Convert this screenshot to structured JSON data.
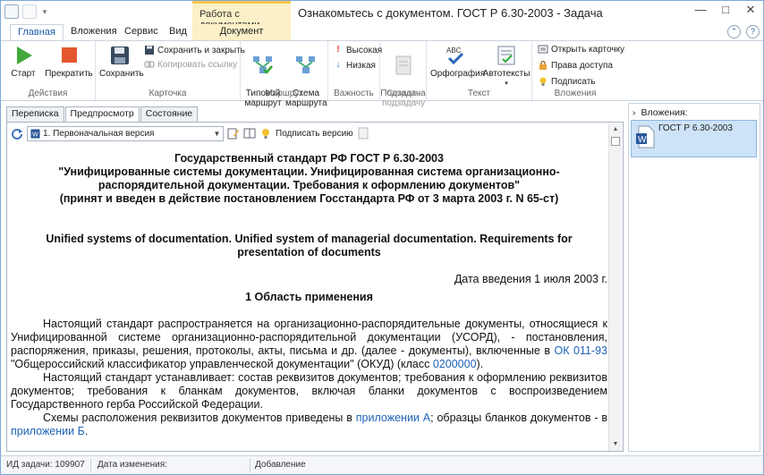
{
  "window": {
    "context_tab_caption": "Работа с документами",
    "title": "Ознакомьтесь с документом. ГОСТ Р 6.30-2003 - Задача",
    "controls": [
      "—",
      "□",
      "✕"
    ]
  },
  "ribbon_tabs": [
    {
      "label": "Главная",
      "active": true
    },
    {
      "label": "Вложения"
    },
    {
      "label": "Сервис"
    },
    {
      "label": "Вид"
    },
    {
      "label": "Документ",
      "contextual": true
    }
  ],
  "ribbon": {
    "groups": {
      "actions": "Действия",
      "card": "Карточка",
      "route": "Маршрут",
      "importance": "Важность",
      "subtask": "Подзадача",
      "text": "Текст",
      "attachments": "Вложения"
    },
    "start": "Старт",
    "stop": "Прекратить",
    "save": "Сохранить",
    "save_close": "Сохранить и закрыть",
    "copy_link": "Копировать ссылку",
    "typical_route": "Типовой\nмаршрут",
    "route_scheme": "Схема\nмаршрута",
    "high": "Высокая",
    "low": "Низкая",
    "create_subtask": "Создать\nподзадачу",
    "spelling": "Орфография",
    "autotexts": "Автотексты",
    "open_card": "Открыть карточку",
    "access": "Права доступа",
    "sign": "Подписать"
  },
  "doc_tabs": [
    {
      "label": "Переписка"
    },
    {
      "label": "Предпросмотр",
      "active": true
    },
    {
      "label": "Состояние"
    }
  ],
  "doc_toolbar": {
    "version": "1. Первоначальная версия",
    "sign_version": "Подписать версию"
  },
  "document": {
    "title1": "Государственный стандарт РФ ГОСТ Р 6.30-2003",
    "title2": "\"Унифицированные системы документации. Унифицированная система организационно-распорядительной документации. Требования к оформлению документов\"",
    "title3": "(принят и введен в действие постановлением Госстандарта РФ от 3 марта 2003 г. N 65-ст)",
    "title_en": "Unified systems of documentation. Unified system of managerial documentation. Requirements for presentation of documents",
    "date": "Дата введения 1 июля 2003 г.",
    "section1": "1 Область применения",
    "p1_a": "Настоящий стандарт распространяется на организационно-распорядительные документы, относящиеся к Унифицированной системе организационно-распорядительной документации (УСОРД), - постановления, распоряжения, приказы, решения, протоколы, акты, письма и др. (далее - документы), включенные в ",
    "p1_link1": "ОК 011-93",
    "p1_b": " \"Общероссийский классификатор управленческой документации\" (ОКУД) (класс ",
    "p1_link2": "0200000",
    "p1_c": ").",
    "p2": "Настоящий стандарт устанавливает: состав реквизитов документов; требования к оформлению реквизитов документов; требования к бланкам документов, включая бланки документов с воспроизведением Государственного герба Российской Федерации.",
    "p3_a": "Схемы расположения реквизитов документов приведены в ",
    "p3_link1": "приложении А",
    "p3_b": "; образцы бланков документов - в ",
    "p3_link2": "приложении Б",
    "p3_c": "."
  },
  "attachments": {
    "header": "Вложения:",
    "items": [
      "ГОСТ Р 6.30-2003"
    ]
  },
  "status": {
    "task_id": "ИД задачи: 109907",
    "modified": "Дата изменения:",
    "added": "Добавление"
  }
}
